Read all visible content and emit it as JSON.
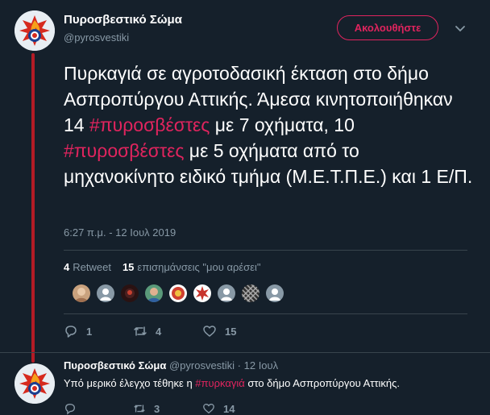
{
  "tweet": {
    "author_name": "Πυροσβεστικό Σώμα",
    "author_handle": "@pyrosvestiki",
    "follow_label": "Ακολουθήστε",
    "text_parts": [
      "Πυρκαγιά σε αγροτοδασική έκταση στο δήμο Ασπροπύργου Αττικής. Άμεσα κινητοποιήθηκαν 14 ",
      "#πυροσβέστες",
      " με 7 οχήματα, 10 ",
      "#πυροσβέστες",
      " με 5 οχήματα από το μηχανοκίνητο ειδικό τμήμα (Μ.Ε.Τ.Π.Ε.) και 1 Ε/Π."
    ],
    "timestamp": "6:27 π.μ. - 12 Ιουλ 2019",
    "retweet_count": "4",
    "retweet_label": "Retweet",
    "like_count": "15",
    "like_label": "επισημάνσεις \"μου αρέσει\"",
    "reply_count": "1",
    "retweets": "4",
    "likes": "15"
  },
  "likers": [
    {
      "icon": "liker-avatar-photo",
      "color": "#c9a27e"
    },
    {
      "icon": "liker-avatar-default",
      "color": "#8899a6"
    },
    {
      "icon": "liker-avatar-photo",
      "color": "#3a1a1a"
    },
    {
      "icon": "liker-avatar-photo",
      "color": "#5a9a7a"
    },
    {
      "icon": "liker-avatar-photo",
      "color": "#d04030"
    },
    {
      "icon": "liker-avatar-photo",
      "color": "#c8342c"
    },
    {
      "icon": "liker-avatar-default",
      "color": "#8899a6"
    },
    {
      "icon": "liker-avatar-pattern",
      "color": "#555555"
    },
    {
      "icon": "liker-avatar-default",
      "color": "#8899a6"
    }
  ],
  "reply": {
    "author_name": "Πυροσβεστικό Σώμα",
    "meta": "@pyrosvestiki · 12 Ιουλ",
    "text_before": "Υπό μερικό έλεγχο τέθηκε η ",
    "hashtag": "#πυρκαγιά",
    "text_after": " στο δήμο Ασπροπύργου Αττικής.",
    "reply_count": "",
    "retweet_count": "3",
    "like_count": "14"
  },
  "colors": {
    "background": "#15202b",
    "accent": "#e0245e",
    "muted": "#8899a6",
    "thread_line": "#b31b25"
  }
}
